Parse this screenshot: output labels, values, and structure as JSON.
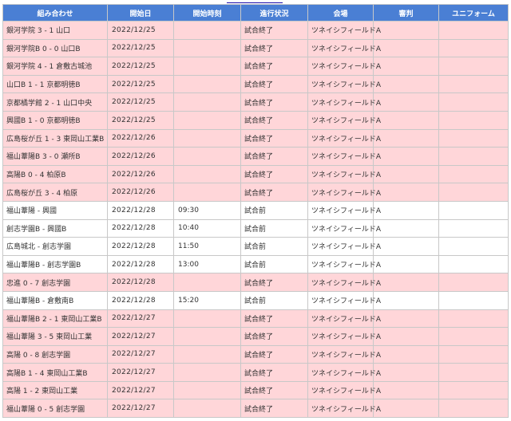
{
  "table": {
    "headers": [
      "組み合わせ",
      "開始日",
      "開始時刻",
      "進行状況",
      "会場",
      "審判",
      "ユニフォーム"
    ],
    "rows": [
      {
        "match": "銀河学院 3 - 1 山口",
        "date": "2022/12/25",
        "time": "",
        "status": "試合終了",
        "venue": "ツネイシフィールドA",
        "referee": "",
        "uniform": "",
        "state": "done"
      },
      {
        "match": "銀河学院B 0 - 0 山口B",
        "date": "2022/12/25",
        "time": "",
        "status": "試合終了",
        "venue": "ツネイシフィールドA",
        "referee": "",
        "uniform": "",
        "state": "done"
      },
      {
        "match": "銀河学院 4 - 1 倉敷古城池",
        "date": "2022/12/25",
        "time": "",
        "status": "試合終了",
        "venue": "ツネイシフィールドA",
        "referee": "",
        "uniform": "",
        "state": "done"
      },
      {
        "match": "山口B 1 - 1 京都明徳B",
        "date": "2022/12/25",
        "time": "",
        "status": "試合終了",
        "venue": "ツネイシフィールドA",
        "referee": "",
        "uniform": "",
        "state": "done"
      },
      {
        "match": "京都橘学館 2 - 1 山口中央",
        "date": "2022/12/25",
        "time": "",
        "status": "試合終了",
        "venue": "ツネイシフィールドA",
        "referee": "",
        "uniform": "",
        "state": "done"
      },
      {
        "match": "興國B 1 - 0 京都明徳B",
        "date": "2022/12/25",
        "time": "",
        "status": "試合終了",
        "venue": "ツネイシフィールドA",
        "referee": "",
        "uniform": "",
        "state": "done"
      },
      {
        "match": "広島桜が丘 1 - 3 東岡山工業B",
        "date": "2022/12/26",
        "time": "",
        "status": "試合終了",
        "venue": "ツネイシフィールドA",
        "referee": "",
        "uniform": "",
        "state": "done"
      },
      {
        "match": "福山葦陽B 3 - 0 瀬所B",
        "date": "2022/12/26",
        "time": "",
        "status": "試合終了",
        "venue": "ツネイシフィールドA",
        "referee": "",
        "uniform": "",
        "state": "done"
      },
      {
        "match": "高陽B 0 - 4 柏原B",
        "date": "2022/12/26",
        "time": "",
        "status": "試合終了",
        "venue": "ツネイシフィールドA",
        "referee": "",
        "uniform": "",
        "state": "done"
      },
      {
        "match": "広島桜が丘 3 - 4 柏原",
        "date": "2022/12/26",
        "time": "",
        "status": "試合終了",
        "venue": "ツネイシフィールドA",
        "referee": "",
        "uniform": "",
        "state": "done"
      },
      {
        "match": "福山葦陽 - 興國",
        "date": "2022/12/28",
        "time": "09:30",
        "status": "試合前",
        "venue": "ツネイシフィールドA",
        "referee": "",
        "uniform": "",
        "state": "pending"
      },
      {
        "match": "創志学園B - 興國B",
        "date": "2022/12/28",
        "time": "10:40",
        "status": "試合前",
        "venue": "ツネイシフィールドA",
        "referee": "",
        "uniform": "",
        "state": "pending"
      },
      {
        "match": "広島城北 - 創志学園",
        "date": "2022/12/28",
        "time": "11:50",
        "status": "試合前",
        "venue": "ツネイシフィールドA",
        "referee": "",
        "uniform": "",
        "state": "pending"
      },
      {
        "match": "福山葦陽B - 創志学園B",
        "date": "2022/12/28",
        "time": "13:00",
        "status": "試合前",
        "venue": "ツネイシフィールドA",
        "referee": "",
        "uniform": "",
        "state": "pending"
      },
      {
        "match": "忠進 0 - 7 創志学園",
        "date": "2022/12/28",
        "time": "",
        "status": "試合終了",
        "venue": "ツネイシフィールドA",
        "referee": "",
        "uniform": "",
        "state": "done"
      },
      {
        "match": "福山葦陽B - 倉敷南B",
        "date": "2022/12/28",
        "time": "15:20",
        "status": "試合前",
        "venue": "ツネイシフィールドA",
        "referee": "",
        "uniform": "",
        "state": "pending"
      },
      {
        "match": "福山葦陽B 2 - 1 東岡山工業B",
        "date": "2022/12/27",
        "time": "",
        "status": "試合終了",
        "venue": "ツネイシフィールドA",
        "referee": "",
        "uniform": "",
        "state": "done"
      },
      {
        "match": "福山葦陽 3 - 5 東岡山工業",
        "date": "2022/12/27",
        "time": "",
        "status": "試合終了",
        "venue": "ツネイシフィールドA",
        "referee": "",
        "uniform": "",
        "state": "done"
      },
      {
        "match": "高陽 0 - 8 創志学園",
        "date": "2022/12/27",
        "time": "",
        "status": "試合終了",
        "venue": "ツネイシフィールドA",
        "referee": "",
        "uniform": "",
        "state": "done"
      },
      {
        "match": "高陽B 1 - 4 東岡山工業B",
        "date": "2022/12/27",
        "time": "",
        "status": "試合終了",
        "venue": "ツネイシフィールドA",
        "referee": "",
        "uniform": "",
        "state": "done"
      },
      {
        "match": "高陽 1 - 2 東岡山工業",
        "date": "2022/12/27",
        "time": "",
        "status": "試合終了",
        "venue": "ツネイシフィールドA",
        "referee": "",
        "uniform": "",
        "state": "done"
      },
      {
        "match": "福山葦陽 0 - 5 創志学園",
        "date": "2022/12/27",
        "time": "",
        "status": "試合終了",
        "venue": "ツネイシフィールドA",
        "referee": "",
        "uniform": "",
        "state": "done"
      }
    ]
  }
}
